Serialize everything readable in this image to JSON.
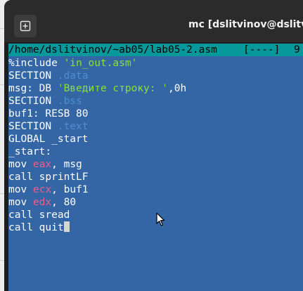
{
  "window": {
    "title": "mc [dslitvinov@dslitvin"
  },
  "editor": {
    "filepath": "/home/dslitvinov/~ab05/lab05-2.asm",
    "flags": "[----]",
    "column": "9"
  },
  "code": {
    "l1": {
      "kw": "%include ",
      "str": "'in_out.asm'"
    },
    "l2": {
      "kw": "SECTION ",
      "sec": ".data"
    },
    "l3": {
      "kw": "msg: DB ",
      "str": "'Введите строку: '",
      "rest": ",0h"
    },
    "l4": {
      "kw": "SECTION ",
      "sec": ".bss"
    },
    "l5": {
      "text": "buf1: RESB 80"
    },
    "l6": {
      "kw": "SECTION ",
      "sec": ".text"
    },
    "l7": {
      "text": "GLOBAL _start"
    },
    "l8": {
      "text": "_start:"
    },
    "l9": {
      "kw": "mov ",
      "reg": "eax",
      "rest": ", msg"
    },
    "l10": {
      "text": "call sprintLF"
    },
    "l11": {
      "kw": "mov ",
      "reg": "ecx",
      "rest": ", buf1"
    },
    "l12": {
      "kw": "mov ",
      "reg": "edx",
      "rest": ", 80"
    },
    "l13": {
      "text": "call sread"
    },
    "l14": {
      "text": "call quit"
    }
  },
  "colors": {
    "editor_bg": "#3465a4",
    "status_bar": "#06989a",
    "string": "#8ae234",
    "section": "#4e8fd1",
    "register": "#ef5d8a",
    "titlebar": "#2b2b2b"
  },
  "icons": {
    "new_tab": "new-tab-icon",
    "mouse": "mouse-pointer-icon"
  }
}
